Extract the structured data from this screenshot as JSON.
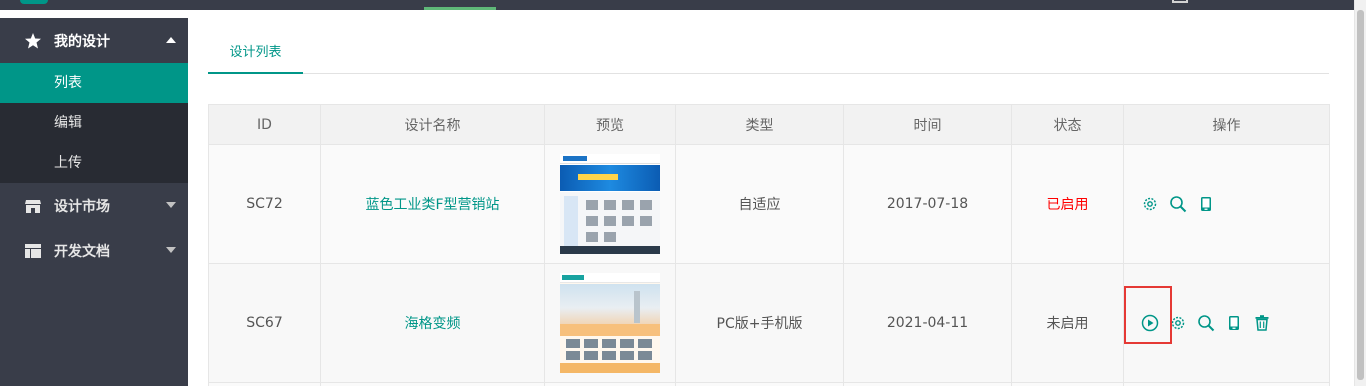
{
  "sidebar": {
    "my_design": "我的设计",
    "sub_items": [
      "列表",
      "编辑",
      "上传"
    ],
    "design_market": "设计市场",
    "dev_docs": "开发文档"
  },
  "tabs": [
    "设计列表"
  ],
  "table": {
    "headers": [
      "ID",
      "设计名称",
      "预览",
      "类型",
      "时间",
      "状态",
      "操作"
    ],
    "rows": [
      {
        "id": "SC72",
        "name": "蓝色工业类F型营销站",
        "type": "自适应",
        "date": "2017-07-18",
        "status": "已启用"
      },
      {
        "id": "SC67",
        "name": "海格变频",
        "type": "PC版+手机版",
        "date": "2021-04-11",
        "status": "未启用"
      }
    ]
  },
  "colors": {
    "accent": "#009688",
    "sidebar_bg": "#393d49",
    "status_enabled": "#ff0000",
    "highlight": "#e53935"
  },
  "icons": {
    "row1_ops": [
      "gear-icon",
      "search-icon",
      "mobile-icon"
    ],
    "row2_ops": [
      "play-icon",
      "gear-icon",
      "search-icon",
      "mobile-icon",
      "trash-icon"
    ]
  }
}
